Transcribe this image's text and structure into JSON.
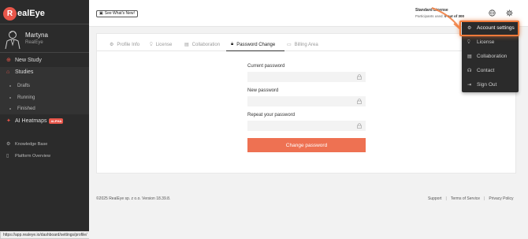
{
  "sidebar": {
    "logo": {
      "mark": "R",
      "text": "ealEye"
    },
    "user": {
      "name": "Martyna",
      "org": "RealEye"
    },
    "nav": {
      "new_study": "New Study",
      "studies": "Studies",
      "drafts": "Drafts",
      "running": "Running",
      "finished": "Finished",
      "heatmaps": "AI Heatmaps",
      "heatmaps_badge": "ALPHA",
      "knowledge_base": "Knowledge Base",
      "platform_overview": "Platform Overview"
    },
    "status_url": "https://app.realeye.io/dashboard/settings/profile/"
  },
  "header": {
    "whats_new": "See What's New!",
    "license_title": "Standard License",
    "participants_prefix": "Participants used:",
    "participants_value": "0 out of 300"
  },
  "tabs": [
    {
      "label": "Profile Info",
      "icon": "gear-icon"
    },
    {
      "label": "License",
      "icon": "license-icon"
    },
    {
      "label": "Collaboration",
      "icon": "collaboration-icon"
    },
    {
      "label": "Password Change",
      "icon": "lock-icon",
      "active": true
    },
    {
      "label": "Billing Area",
      "icon": "billing-icon"
    }
  ],
  "form": {
    "current_label": "Current password",
    "new_label": "New password",
    "repeat_label": "Repeat your password",
    "current_value": "",
    "new_value": "",
    "repeat_value": "",
    "submit_label": "Change password"
  },
  "footer": {
    "copyright": "©2025 RealEye sp. z o.o. Version 18.39.8.",
    "support": "Support",
    "terms": "Terms of Service",
    "privacy": "Privacy Policy"
  },
  "dropdown": {
    "items": [
      {
        "label": "Account settings",
        "icon": "gear-icon",
        "active": true
      },
      {
        "label": "License",
        "icon": "license-icon"
      },
      {
        "label": "Collaboration",
        "icon": "collaboration-icon"
      },
      {
        "label": "Contact",
        "icon": "headset-icon"
      },
      {
        "label": "Sign Out",
        "icon": "signout-icon"
      }
    ]
  },
  "colors": {
    "accent": "#e8564a",
    "button": "#ee7152",
    "highlight": "#f07a3a",
    "sidebar": "#2b2b2b"
  }
}
